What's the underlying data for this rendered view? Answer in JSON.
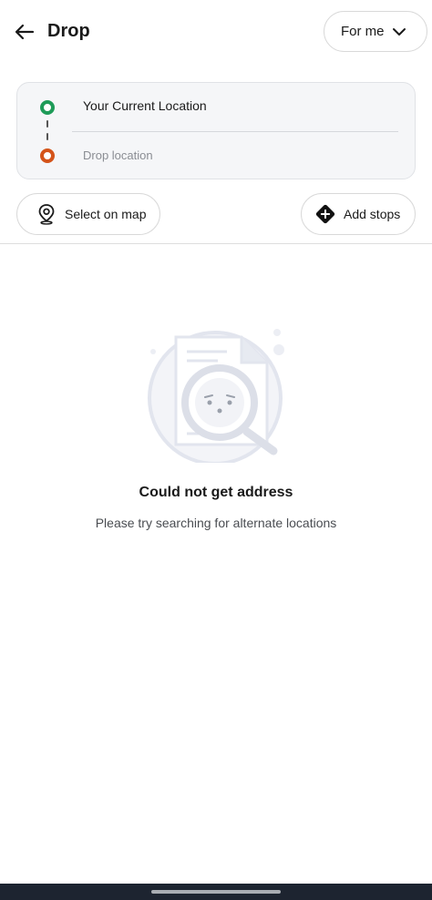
{
  "header": {
    "title": "Drop",
    "for_label": "For me"
  },
  "locations": {
    "current": "Your Current Location",
    "drop_placeholder": "Drop location"
  },
  "actions": {
    "select_on_map": "Select on map",
    "add_stops": "Add stops"
  },
  "empty_state": {
    "title": "Could not get address",
    "subtitle": "Please try searching for alternate locations"
  },
  "colors": {
    "pickup_pin": "#1e9b58",
    "drop_pin": "#d4541a",
    "illustration": "#e9ecf4"
  }
}
